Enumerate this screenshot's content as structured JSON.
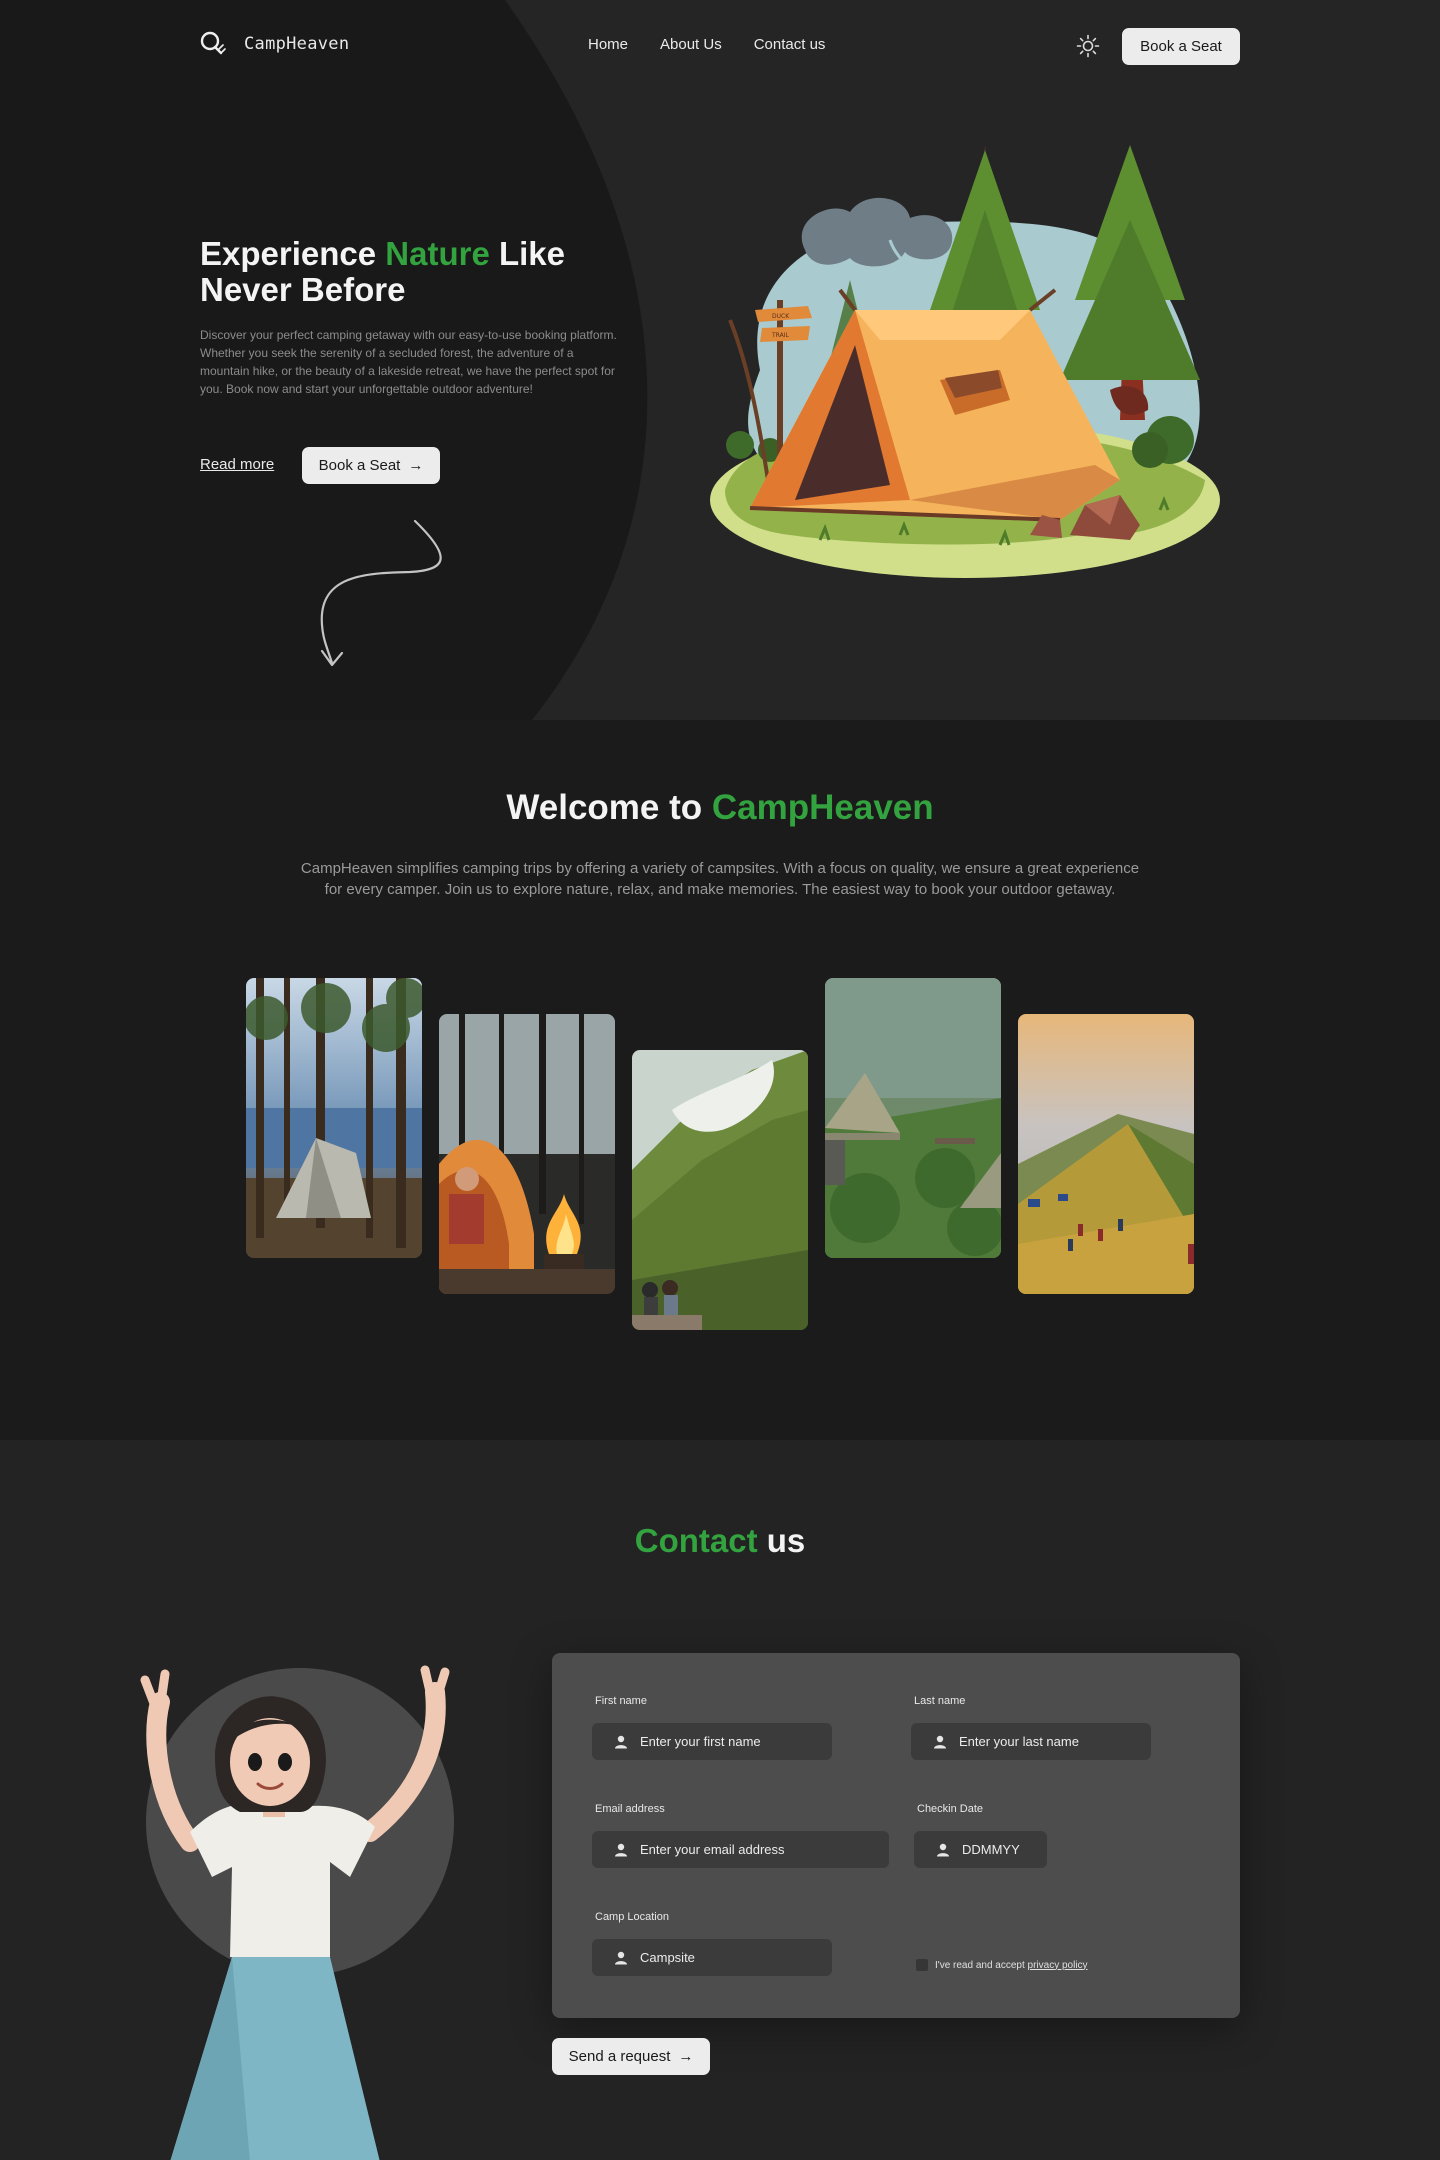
{
  "nav": {
    "brand": "CampHeaven",
    "links": [
      "Home",
      "About Us",
      "Contact us"
    ],
    "cta": "Book  a Seat"
  },
  "hero": {
    "title_part1": "Experience ",
    "title_highlight": "Nature",
    "title_part2": " Like Never Before",
    "description": "Discover your perfect camping getaway with our easy-to-use booking platform. Whether you seek the serenity of a secluded forest, the adventure of a mountain hike, or the beauty of a lakeside retreat, we have the perfect spot for you. Book now and start your unforgettable outdoor adventure!",
    "read_more": "Read more",
    "cta": "Book  a Seat",
    "sign_line1": "DUCK",
    "sign_line2": "TRAIL"
  },
  "welcome": {
    "title_part1": "Welcome to ",
    "title_highlight": "CampHeaven",
    "description": "CampHeaven simplifies camping trips by offering a variety of campsites. With a focus on quality, we ensure a great experience for every camper. Join us to explore nature, relax, and make memories. The easiest way to book your outdoor getaway."
  },
  "contact": {
    "title_highlight": "Contact",
    "title_part2": " us",
    "labels": {
      "first_name": "First name",
      "last_name": "Last name",
      "email": "Email  address",
      "checkin": "Checkin Date",
      "location": "Camp Location"
    },
    "placeholders": {
      "first_name": "Enter your first name",
      "last_name": "Enter your last name",
      "email": "Enter your email address",
      "checkin": "DDMMYY",
      "location": "Campsite"
    },
    "consent_text": "I've read and accept ",
    "consent_link": "privacy policy",
    "submit": "Send a request"
  },
  "colors": {
    "accent": "#33a33f",
    "hero_bg": "#252525",
    "hero_curve": "#191919",
    "card": "#4d4d4d"
  },
  "icons": [
    "search-icon",
    "sun-icon",
    "arrow-right-icon",
    "user-icon",
    "curly-arrow-icon"
  ]
}
